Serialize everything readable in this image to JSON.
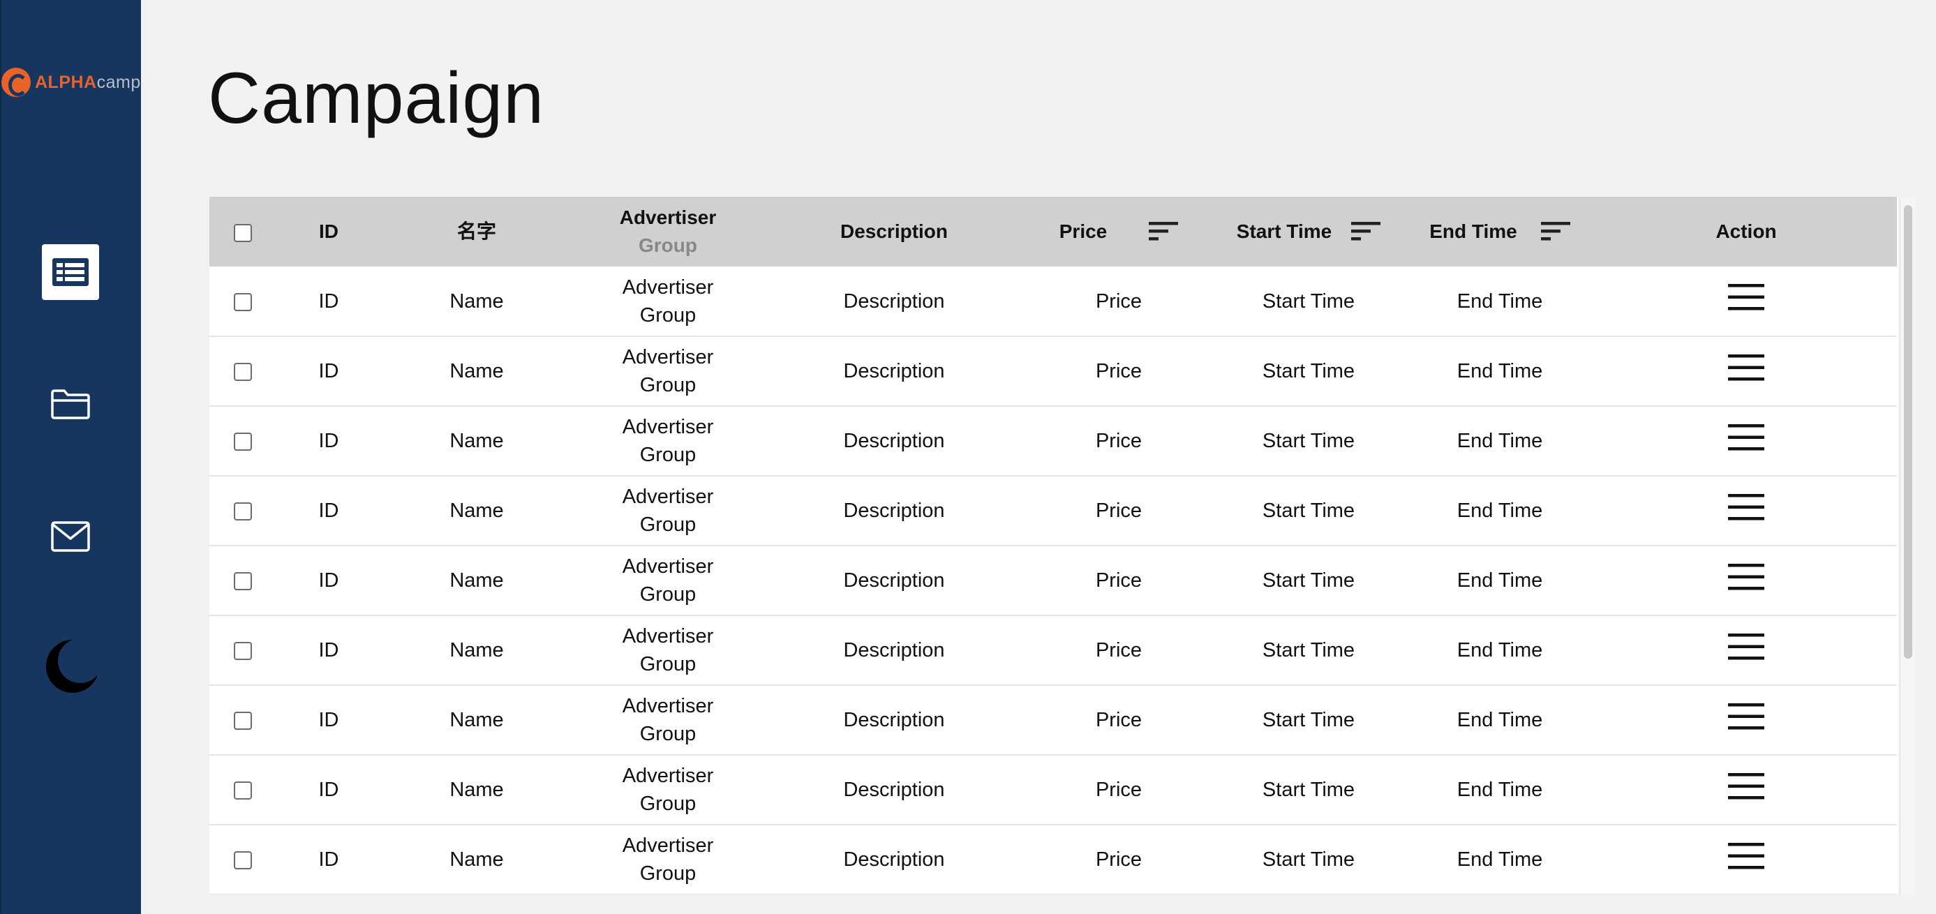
{
  "logo": {
    "brand": "ALPHA",
    "suffix": "camp"
  },
  "page_title": "Campaign",
  "nav": {
    "items": [
      {
        "icon": "table-icon",
        "active": true
      },
      {
        "icon": "folder-icon",
        "active": false
      },
      {
        "icon": "mail-icon",
        "active": false
      },
      {
        "icon": "moon-icon",
        "active": false
      }
    ]
  },
  "table": {
    "headers": {
      "id": "ID",
      "name": "名字",
      "advertiser": "Advertiser",
      "advertiser_sub": "Group",
      "description": "Description",
      "price": "Price",
      "start_time": "Start Time",
      "end_time": "End Time",
      "action": "Action"
    },
    "rows": [
      {
        "id": "ID",
        "name": "Name",
        "advertiser": "Advertiser",
        "group": "Group",
        "description": "Description",
        "price": "Price",
        "start_time": "Start Time",
        "end_time": "End Time"
      },
      {
        "id": "ID",
        "name": "Name",
        "advertiser": "Advertiser",
        "group": "Group",
        "description": "Description",
        "price": "Price",
        "start_time": "Start Time",
        "end_time": "End Time"
      },
      {
        "id": "ID",
        "name": "Name",
        "advertiser": "Advertiser",
        "group": "Group",
        "description": "Description",
        "price": "Price",
        "start_time": "Start Time",
        "end_time": "End Time"
      },
      {
        "id": "ID",
        "name": "Name",
        "advertiser": "Advertiser",
        "group": "Group",
        "description": "Description",
        "price": "Price",
        "start_time": "Start Time",
        "end_time": "End Time"
      },
      {
        "id": "ID",
        "name": "Name",
        "advertiser": "Advertiser",
        "group": "Group",
        "description": "Description",
        "price": "Price",
        "start_time": "Start Time",
        "end_time": "End Time"
      },
      {
        "id": "ID",
        "name": "Name",
        "advertiser": "Advertiser",
        "group": "Group",
        "description": "Description",
        "price": "Price",
        "start_time": "Start Time",
        "end_time": "End Time"
      },
      {
        "id": "ID",
        "name": "Name",
        "advertiser": "Advertiser",
        "group": "Group",
        "description": "Description",
        "price": "Price",
        "start_time": "Start Time",
        "end_time": "End Time"
      },
      {
        "id": "ID",
        "name": "Name",
        "advertiser": "Advertiser",
        "group": "Group",
        "description": "Description",
        "price": "Price",
        "start_time": "Start Time",
        "end_time": "End Time"
      },
      {
        "id": "ID",
        "name": "Name",
        "advertiser": "Advertiser",
        "group": "Group",
        "description": "Description",
        "price": "Price",
        "start_time": "Start Time",
        "end_time": "End Time"
      }
    ]
  },
  "colors": {
    "sidebar_bg": "#16365f",
    "brand_orange": "#e8622a",
    "header_bg": "#d0d0d0",
    "page_bg": "#f2f2f2"
  }
}
